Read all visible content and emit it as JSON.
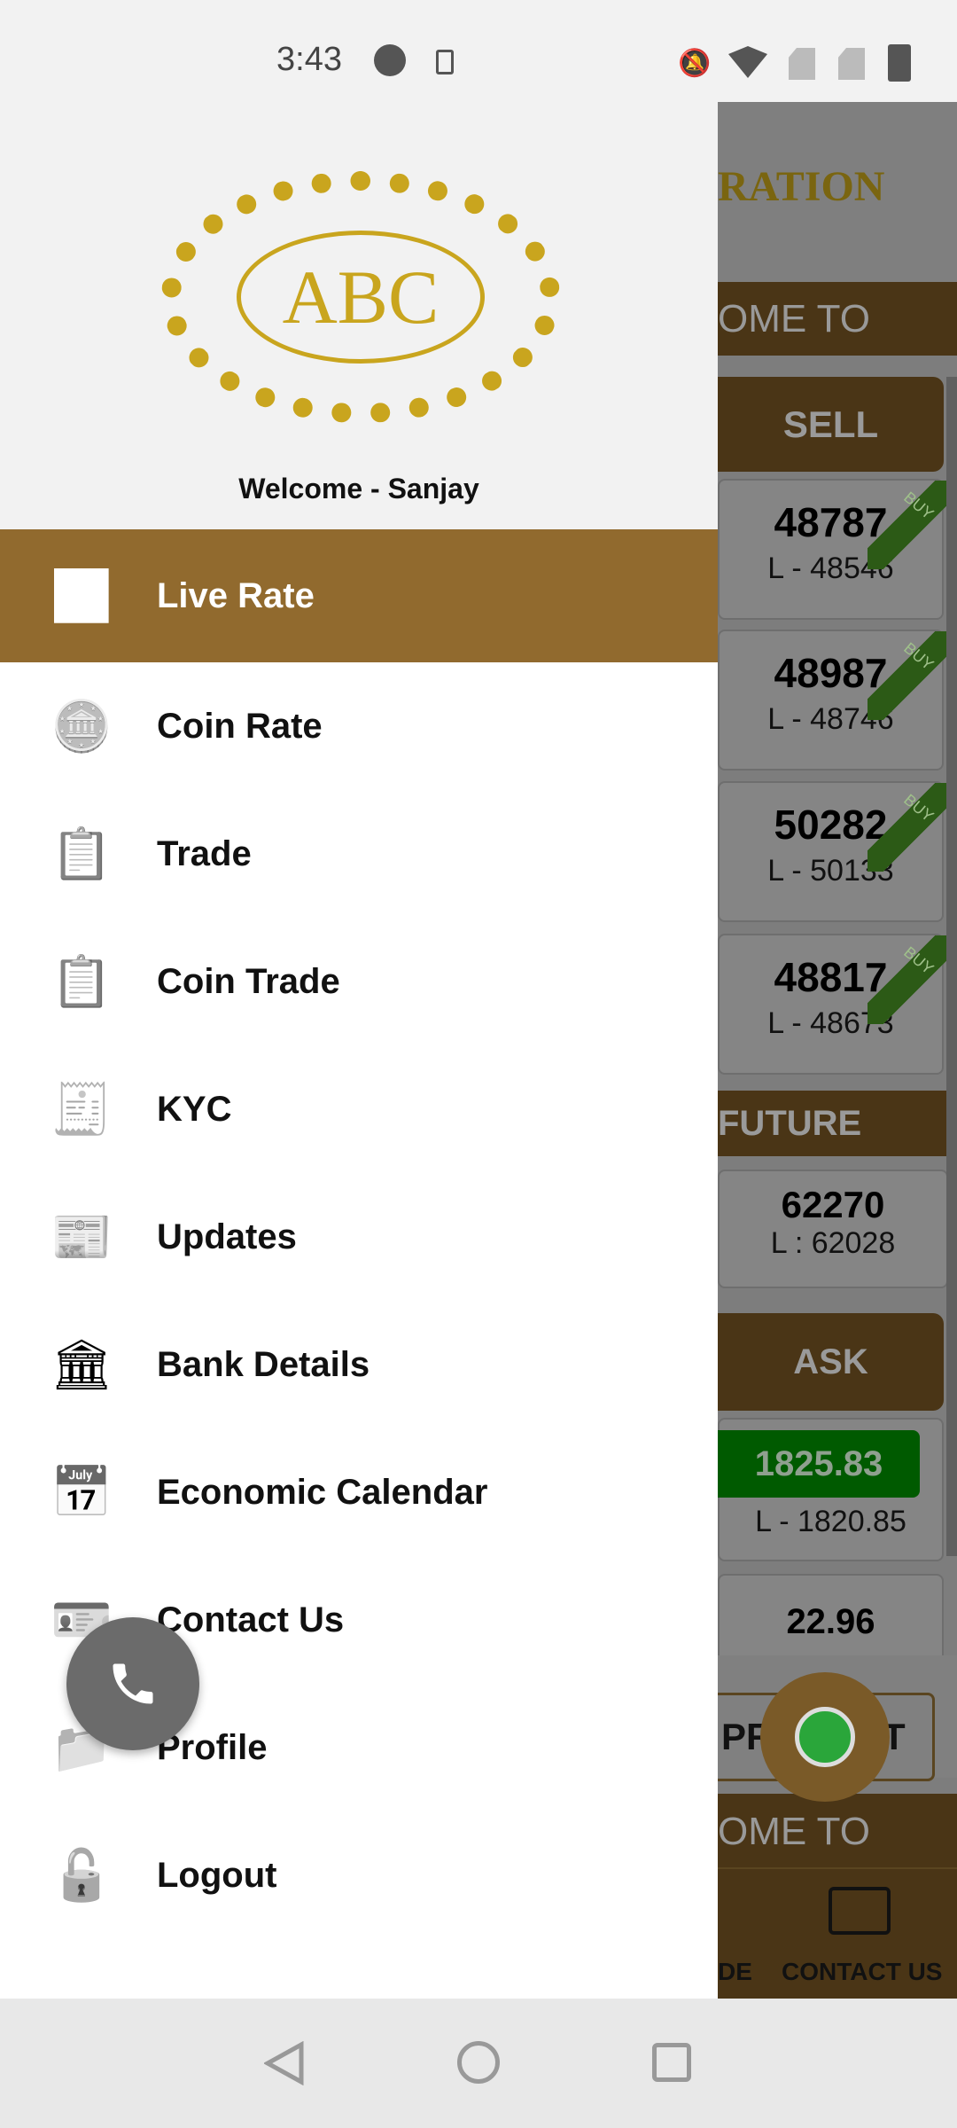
{
  "status_bar": {
    "time": "3:43"
  },
  "drawer": {
    "logo_text": "ABC",
    "welcome": "Welcome - Sanjay",
    "items": [
      {
        "label": "Live Rate",
        "icon": "chart-icon",
        "active": true
      },
      {
        "label": "Coin Rate",
        "icon": "gold-bars-icon"
      },
      {
        "label": "Trade",
        "icon": "clipboard-chart-icon"
      },
      {
        "label": "Coin Trade",
        "icon": "clipboard-chart-icon"
      },
      {
        "label": "KYC",
        "icon": "document-check-icon"
      },
      {
        "label": "Updates",
        "icon": "newspaper-icon"
      },
      {
        "label": "Bank Details",
        "icon": "bank-icon"
      },
      {
        "label": "Economic Calendar",
        "icon": "calendar-chart-icon"
      },
      {
        "label": "Contact Us",
        "icon": "contact-card-icon"
      },
      {
        "label": "Profile",
        "icon": "folder-icon"
      },
      {
        "label": "Logout",
        "icon": "lock-user-icon"
      }
    ]
  },
  "background": {
    "title_fragment": "RATION",
    "marquee": "OME TO AGRO",
    "sell_label": "SELL",
    "ribbon": "BUY",
    "rates": [
      {
        "value": "48787",
        "low": "L - 48546"
      },
      {
        "value": "48987",
        "low": "L - 48746"
      },
      {
        "value": "50282",
        "low": "L - 50133"
      },
      {
        "value": "48817",
        "low": "L - 48673"
      }
    ],
    "future_label": "FUTURE",
    "future": {
      "value": "62270",
      "low": "L : 62028"
    },
    "ask_label": "ASK",
    "ask": {
      "value": "1825.83",
      "low": "L - 1820.85"
    },
    "silver": {
      "value": "22.96"
    },
    "product_label": "PRODUCT",
    "bottom_nav": {
      "left_fragment": "DE",
      "contact": "CONTACT US"
    }
  },
  "colors": {
    "accent": "#916a2e",
    "logo_gold": "#c9a51e"
  }
}
